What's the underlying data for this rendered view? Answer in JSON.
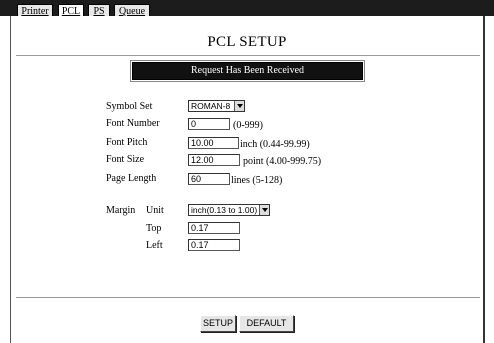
{
  "tabs": [
    {
      "label": "Printer",
      "active": false
    },
    {
      "label": "PCL",
      "active": true
    },
    {
      "label": "PS",
      "active": false
    },
    {
      "label": "Queue",
      "active": false
    }
  ],
  "page": {
    "title": "PCL SETUP",
    "status_banner": "Request Has Been Received"
  },
  "form": {
    "symbol_set": {
      "label": "Symbol Set",
      "value": "ROMAN-8"
    },
    "font_number": {
      "label": "Font Number",
      "value": "0",
      "hint": "(0-999)"
    },
    "font_pitch": {
      "label": "Font Pitch",
      "value": "10.00",
      "hint": "inch (0.44-99.99)"
    },
    "font_size": {
      "label": "Font Size",
      "value": "12.00",
      "hint": "point (4.00-999.75)"
    },
    "page_length": {
      "label": "Page Length",
      "value": "60",
      "hint": "lines (5-128)"
    },
    "margin": {
      "label": "Margin",
      "unit_label": "Unit",
      "unit_value": "inch(0.13 to 1.00)",
      "top_label": "Top",
      "top_value": "0.17",
      "left_label": "Left",
      "left_value": "0.17"
    }
  },
  "buttons": {
    "setup": "SETUP",
    "default": "DEFAULT"
  },
  "colors": {
    "tabbar": "#1c1c1c",
    "banner_bg": "#111111",
    "banner_text": "#ffffff"
  }
}
